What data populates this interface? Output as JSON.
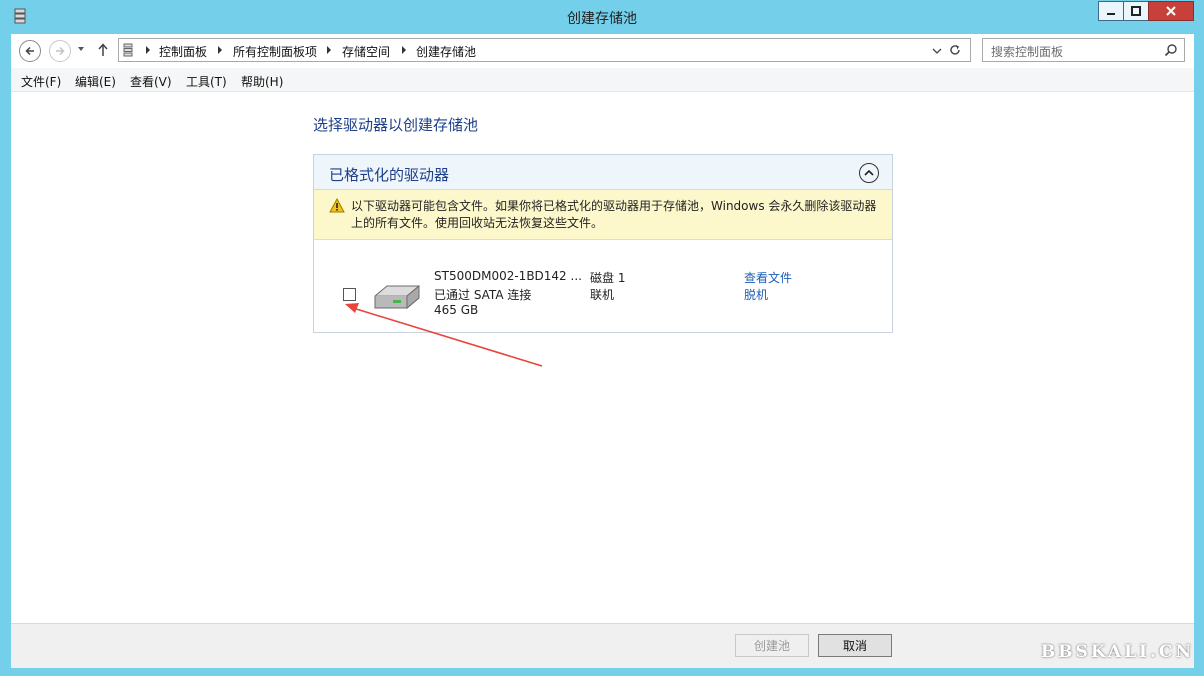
{
  "window": {
    "title": "创建存储池"
  },
  "address": {
    "breadcrumbs": [
      "控制面板",
      "所有控制面板项",
      "存储空间",
      "创建存储池"
    ]
  },
  "search": {
    "placeholder": "搜索控制面板"
  },
  "menu": {
    "items": [
      "文件(F)",
      "编辑(E)",
      "查看(V)",
      "工具(T)",
      "帮助(H)"
    ]
  },
  "main": {
    "heading": "选择驱动器以创建存储池",
    "group": {
      "title": "已格式化的驱动器",
      "warning_line1": "以下驱动器可能包含文件。如果你将已格式化的驱动器用于存储池，Windows 会永久删除该驱动器",
      "warning_line2": "上的所有文件。使用回收站无法恢复这些文件。",
      "drive": {
        "name": "ST500DM002-1BD142 ...",
        "connection": "已通过 SATA 连接",
        "size": "465 GB",
        "disk": "磁盘 1",
        "status": "联机",
        "link_view_files": "查看文件",
        "link_offline": "脱机",
        "checked": false
      }
    }
  },
  "footer": {
    "create_label": "创建池",
    "cancel_label": "取消"
  },
  "watermark": "BBSKALI.CN",
  "colors": {
    "titlebar": "#74cfea",
    "heading_blue": "#1e3f8a",
    "link_blue": "#1c5fb6",
    "warning_bg": "#fdf8cc",
    "annotation_arrow": "#e8453c"
  }
}
